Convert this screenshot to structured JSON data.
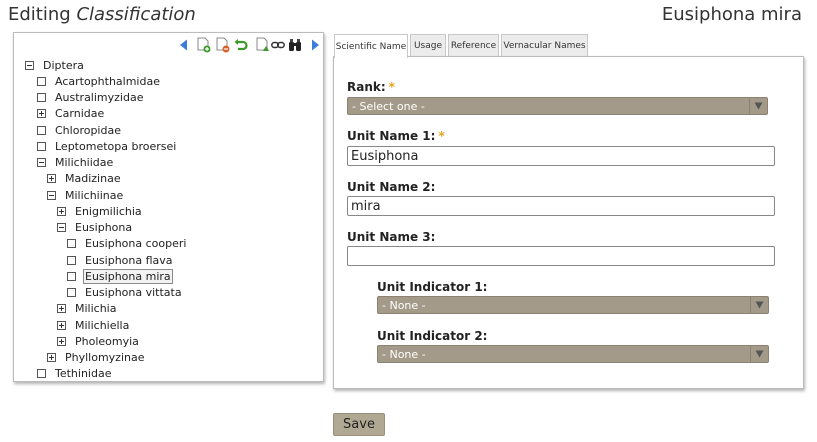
{
  "header": {
    "title_prefix": "Editing",
    "title_object": "Classification",
    "record_name": "Eusiphona mira"
  },
  "toolbar": {
    "buttons": [
      {
        "name": "previous-arrow-icon"
      },
      {
        "name": "add-child-icon"
      },
      {
        "name": "delete-node-icon"
      },
      {
        "name": "undo-icon"
      },
      {
        "name": "move-node-icon"
      },
      {
        "name": "link-icon"
      },
      {
        "name": "binoculars-icon"
      },
      {
        "name": "next-arrow-icon"
      }
    ],
    "colors": {
      "arrow": "#3b7dd8",
      "add": "#3c9a2b",
      "delete": "#d8622b",
      "undo": "#3c9a2b"
    }
  },
  "tree": {
    "nodes": [
      {
        "label": "Diptera",
        "level": 0,
        "toggle": "minus"
      },
      {
        "label": "Acartophthalmidae",
        "level": 1,
        "toggle": "leaf"
      },
      {
        "label": "Australimyzidae",
        "level": 1,
        "toggle": "leaf"
      },
      {
        "label": "Carnidae",
        "level": 1,
        "toggle": "plus"
      },
      {
        "label": "Chloropidae",
        "level": 1,
        "toggle": "leaf"
      },
      {
        "label": "Leptometopa broersei",
        "level": 1,
        "toggle": "leaf"
      },
      {
        "label": "Milichiidae",
        "level": 1,
        "toggle": "minus"
      },
      {
        "label": "Madizinae",
        "level": 2,
        "toggle": "plus"
      },
      {
        "label": "Milichiinae",
        "level": 2,
        "toggle": "minus"
      },
      {
        "label": "Enigmilichia",
        "level": 3,
        "toggle": "plus"
      },
      {
        "label": "Eusiphona",
        "level": 3,
        "toggle": "minus"
      },
      {
        "label": "Eusiphona cooperi",
        "level": 4,
        "toggle": "leaf"
      },
      {
        "label": "Eusiphona flava",
        "level": 4,
        "toggle": "leaf"
      },
      {
        "label": "Eusiphona mira",
        "level": 4,
        "toggle": "leaf",
        "selected": true
      },
      {
        "label": "Eusiphona vittata",
        "level": 4,
        "toggle": "leaf"
      },
      {
        "label": "Milichia",
        "level": 3,
        "toggle": "plus"
      },
      {
        "label": "Milichiella",
        "level": 3,
        "toggle": "plus"
      },
      {
        "label": "Pholeomyia",
        "level": 3,
        "toggle": "plus"
      },
      {
        "label": "Phyllomyzinae",
        "level": 2,
        "toggle": "plus"
      },
      {
        "label": "Tethinidae",
        "level": 1,
        "toggle": "leaf"
      }
    ]
  },
  "tabs": [
    {
      "label": "Scientific Name",
      "active": true
    },
    {
      "label": "Usage",
      "active": false
    },
    {
      "label": "Reference",
      "active": false
    },
    {
      "label": "Vernacular Names",
      "active": false
    }
  ],
  "form": {
    "rank": {
      "label": "Rank:",
      "required_mark": "*",
      "value": "- Select one -"
    },
    "unit_name_1": {
      "label": "Unit Name 1:",
      "required_mark": "*",
      "value": "Eusiphona"
    },
    "unit_name_2": {
      "label": "Unit Name 2:",
      "value": "mira"
    },
    "unit_name_3": {
      "label": "Unit Name 3:",
      "value": ""
    },
    "unit_indicator_1": {
      "label": "Unit Indicator 1:",
      "value": "- None -"
    },
    "unit_indicator_2": {
      "label": "Unit Indicator 2:",
      "value": "- None -"
    }
  },
  "actions": {
    "save_label": "Save"
  },
  "colors": {
    "select_bg": "#a49a89",
    "button_bg": "#b1a894",
    "required": "#e8a317"
  }
}
